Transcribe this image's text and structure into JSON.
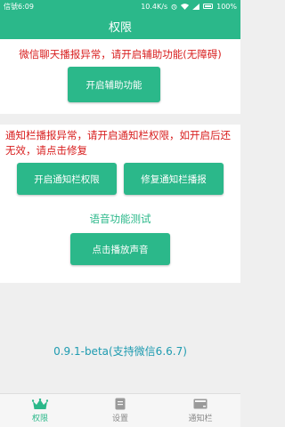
{
  "status_bar": {
    "left": "信號6:09",
    "right_speed": "10.4K/s",
    "battery": "100%"
  },
  "header": {
    "title": "权限"
  },
  "accessibility": {
    "warning": "微信聊天播报异常，请开启辅助功能(无障碍)",
    "button": "开启辅助功能"
  },
  "notification": {
    "warning": "通知栏播报异常，请开启通知栏权限，如开启后还无效，请点击修复",
    "enable_button": "开启通知栏权限",
    "fix_button": "修复通知栏播报"
  },
  "voice_test": {
    "title": "语音功能测试",
    "button": "点击播放声音"
  },
  "version": "0.9.1-beta(支持微信6.6.7)",
  "tabs": [
    {
      "label": "权限",
      "icon": "crown-icon",
      "active": true
    },
    {
      "label": "设置",
      "icon": "settings-doc-icon",
      "active": false
    },
    {
      "label": "通知栏",
      "icon": "notification-bar-icon",
      "active": false
    }
  ],
  "colors": {
    "accent": "#2bb88a",
    "warning": "#d81e1e",
    "version": "#1e9bb0"
  }
}
